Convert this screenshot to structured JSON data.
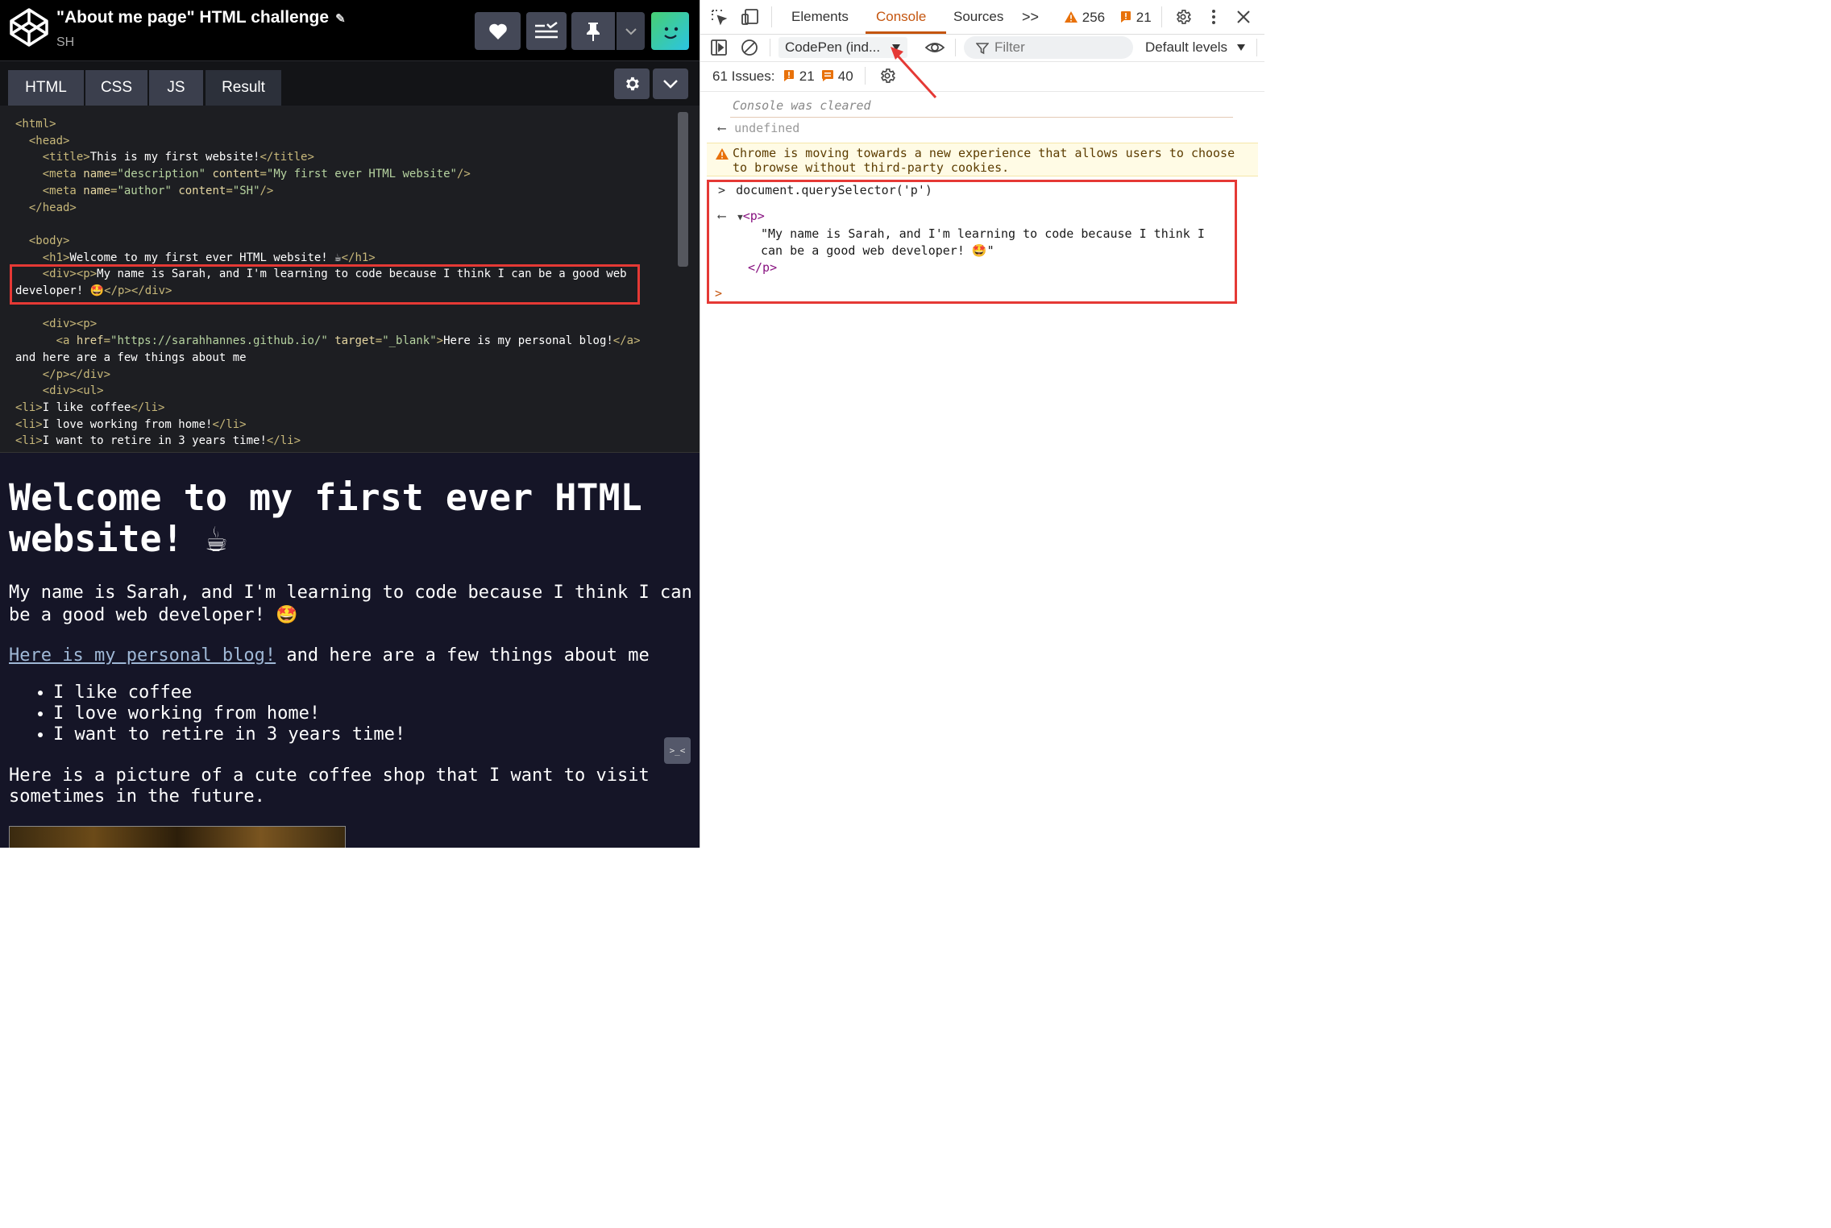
{
  "codepen": {
    "title": "\"About me page\" HTML challenge",
    "author": "SH",
    "tabs": [
      "HTML",
      "CSS",
      "JS",
      "Result"
    ],
    "code": {
      "l1": "<html>",
      "l2": "<head>",
      "l3_tag_open": "<title>",
      "l3_text": "This is my first website!",
      "l3_tag_close": "</title>",
      "l4_tag": "<meta ",
      "l4_attr1": "name",
      "l4_val1": "\"description\"",
      "l4_attr2": "content",
      "l4_val2": "\"My first ever HTML website\"",
      "l4_end": "/>",
      "l5_tag": "<meta ",
      "l5_attr1": "name",
      "l5_val1": "\"author\"",
      "l5_attr2": "content",
      "l5_val2": "\"SH\"",
      "l5_end": "/>",
      "l6": "</head>",
      "l8": "<body>",
      "l9_open": "<h1>",
      "l9_text": "Welcome to my first ever HTML website! ☕",
      "l9_close": "</h1>",
      "l10_open": "<div><p>",
      "l10_text": "My name is Sarah, and I'm learning to code because I think I can be a good web",
      "l11_text": "developer! 🤩",
      "l11_close": "</p></div>",
      "l13": "<div><p>",
      "l14_tag": "<a ",
      "l14_attr1": "href",
      "l14_val1": "\"https://sarahhannes.github.io/\"",
      "l14_attr2": "target",
      "l14_val2": "\"_blank\"",
      "l14_gt": ">",
      "l14_text": "Here is my personal blog!",
      "l14_close": "</a>",
      "l15_text": "and here are a few things about me",
      "l16": "</p></div>",
      "l17": "<div><ul>",
      "li_open": "<li>",
      "li_close": "</li>",
      "li1": "I like coffee",
      "li2": "I love working from home!",
      "li3": "I want to retire in 3 years time!"
    },
    "result": {
      "h1": "Welcome to my first ever HTML website! ☕",
      "p1": "My name is Sarah, and I'm learning to code because I think I can be a good web developer! 🤩",
      "link": "Here is my personal blog!",
      "p2_rest": " and here are a few things about me",
      "list": [
        "I like coffee",
        "I love working from home!",
        "I want to retire in 3 years time!"
      ],
      "p3": "Here is a picture of a cute coffee shop that I want to visit sometimes in the future."
    }
  },
  "devtools": {
    "tabs": {
      "elements": "Elements",
      "console": "Console",
      "sources": "Sources",
      "more": ">>"
    },
    "warnings_count": "256",
    "errors_count": "21",
    "context": "CodePen (ind...",
    "filter_placeholder": "Filter",
    "levels": "Default levels",
    "issues": {
      "label": "61 Issues:",
      "errors": "21",
      "info": "40"
    },
    "console": {
      "cleared": "Console was cleared",
      "undefined": "undefined",
      "warning": "Chrome is moving towards a new experience that allows users to choose to browse without third-party cookies.",
      "command": "document.querySelector('p')",
      "result_open": "<p>",
      "result_text": "\"My name is Sarah, and I'm learning to code because I think I can be a good web developer! 🤩\"",
      "result_close": "</p>"
    }
  },
  "colors": {
    "highlight": "#e53935",
    "console_accent": "#c5560f",
    "codepen_bg": "#1d1e22",
    "result_bg": "#151527"
  }
}
